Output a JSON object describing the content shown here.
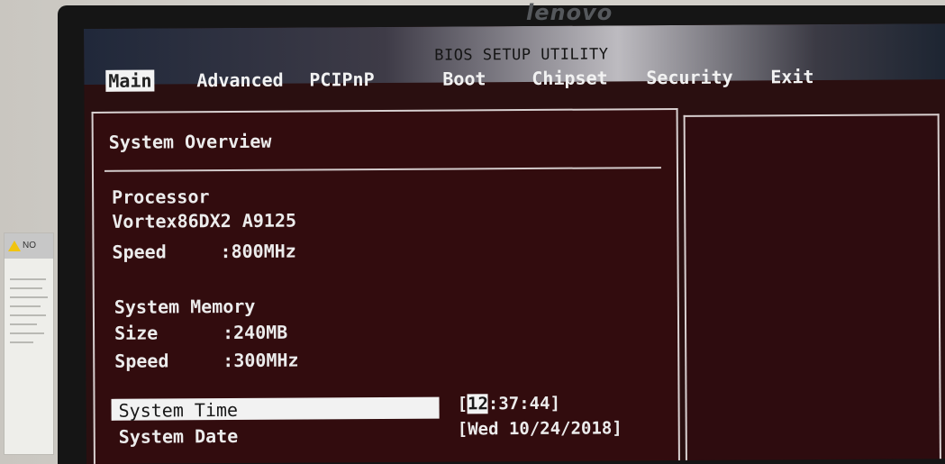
{
  "brand": "lenovo",
  "notice": {
    "heading": "NO"
  },
  "bios": {
    "title": "BIOS SETUP UTILITY",
    "menu": [
      {
        "label": "Main",
        "selected": true
      },
      {
        "label": "Advanced"
      },
      {
        "label": "PCIPnP"
      },
      {
        "label": "Boot"
      },
      {
        "label": "Chipset"
      },
      {
        "label": "Security"
      },
      {
        "label": "Exit"
      }
    ],
    "overview": {
      "heading": "System Overview",
      "processor_label": "Processor",
      "processor_name": "Vortex86DX2 A9125",
      "cpu_speed_label": "Speed",
      "cpu_speed_value": ":800MHz",
      "memory_label": "System Memory",
      "mem_size_label": "Size",
      "mem_size_value": ":240MB",
      "mem_speed_label": "Speed",
      "mem_speed_value": ":300MHz"
    },
    "time": {
      "label": "System Time",
      "open_bracket": "[",
      "hour": "12",
      "rest": ":37:44]"
    },
    "date": {
      "label": "System Date",
      "value": "[Wed 10/24/2018]"
    }
  },
  "colors": {
    "screen_bg": "#2a0f10",
    "text": "#ececec",
    "highlight": "#f2f2f2"
  }
}
